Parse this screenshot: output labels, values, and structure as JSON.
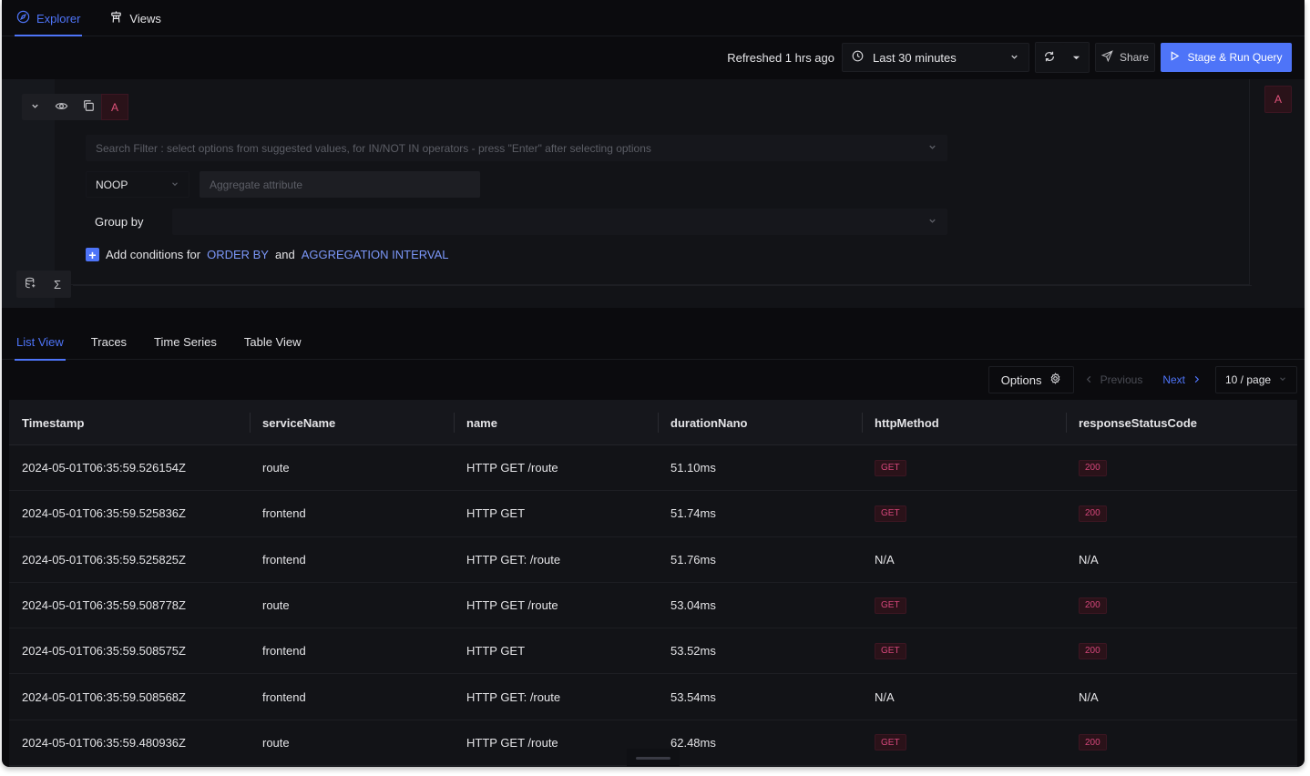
{
  "top_tabs": [
    {
      "label": "Explorer",
      "icon": "compass-icon",
      "active": true
    },
    {
      "label": "Views",
      "icon": "views-tower-icon",
      "active": false
    }
  ],
  "toolbar": {
    "refreshed_text": "Refreshed 1 hrs ago",
    "time_range": "Last 30 minutes",
    "share_label": "Share",
    "run_label": "Stage & Run Query"
  },
  "query": {
    "query_letter": "A",
    "search_placeholder": "Search Filter : select options from suggested values, for IN/NOT IN operators - press \"Enter\" after selecting options",
    "aggregate_operator": "NOOP",
    "aggregate_attribute_placeholder": "Aggregate attribute",
    "group_by_label": "Group by",
    "add_conditions_prefix": "Add conditions for",
    "order_by_link": "ORDER BY",
    "and_text": "and",
    "aggregation_interval_link": "AGGREGATION INTERVAL",
    "formula_letter": "A"
  },
  "view_tabs": [
    {
      "label": "List View",
      "active": true
    },
    {
      "label": "Traces",
      "active": false
    },
    {
      "label": "Time Series",
      "active": false
    },
    {
      "label": "Table View",
      "active": false
    }
  ],
  "pagination": {
    "options_label": "Options",
    "previous_label": "Previous",
    "next_label": "Next",
    "page_size": "10 / page"
  },
  "table": {
    "columns": [
      "Timestamp",
      "serviceName",
      "name",
      "durationNano",
      "httpMethod",
      "responseStatusCode"
    ],
    "rows": [
      {
        "timestamp": "2024-05-01T06:35:59.526154Z",
        "service": "route",
        "name": "HTTP GET /route",
        "duration": "51.10ms",
        "method": "GET",
        "status": "200"
      },
      {
        "timestamp": "2024-05-01T06:35:59.525836Z",
        "service": "frontend",
        "name": "HTTP GET",
        "duration": "51.74ms",
        "method": "GET",
        "status": "200"
      },
      {
        "timestamp": "2024-05-01T06:35:59.525825Z",
        "service": "frontend",
        "name": "HTTP GET: /route",
        "duration": "51.76ms",
        "method": "N/A",
        "status": "N/A"
      },
      {
        "timestamp": "2024-05-01T06:35:59.508778Z",
        "service": "route",
        "name": "HTTP GET /route",
        "duration": "53.04ms",
        "method": "GET",
        "status": "200"
      },
      {
        "timestamp": "2024-05-01T06:35:59.508575Z",
        "service": "frontend",
        "name": "HTTP GET",
        "duration": "53.52ms",
        "method": "GET",
        "status": "200"
      },
      {
        "timestamp": "2024-05-01T06:35:59.508568Z",
        "service": "frontend",
        "name": "HTTP GET: /route",
        "duration": "53.54ms",
        "method": "N/A",
        "status": "N/A"
      },
      {
        "timestamp": "2024-05-01T06:35:59.480936Z",
        "service": "route",
        "name": "HTTP GET /route",
        "duration": "62.48ms",
        "method": "GET",
        "status": "200"
      }
    ]
  },
  "colors": {
    "accent": "#4e74f8",
    "badge_text": "#d4467a",
    "badge_bg": "#2a1219",
    "background": "#0b0b0e"
  }
}
